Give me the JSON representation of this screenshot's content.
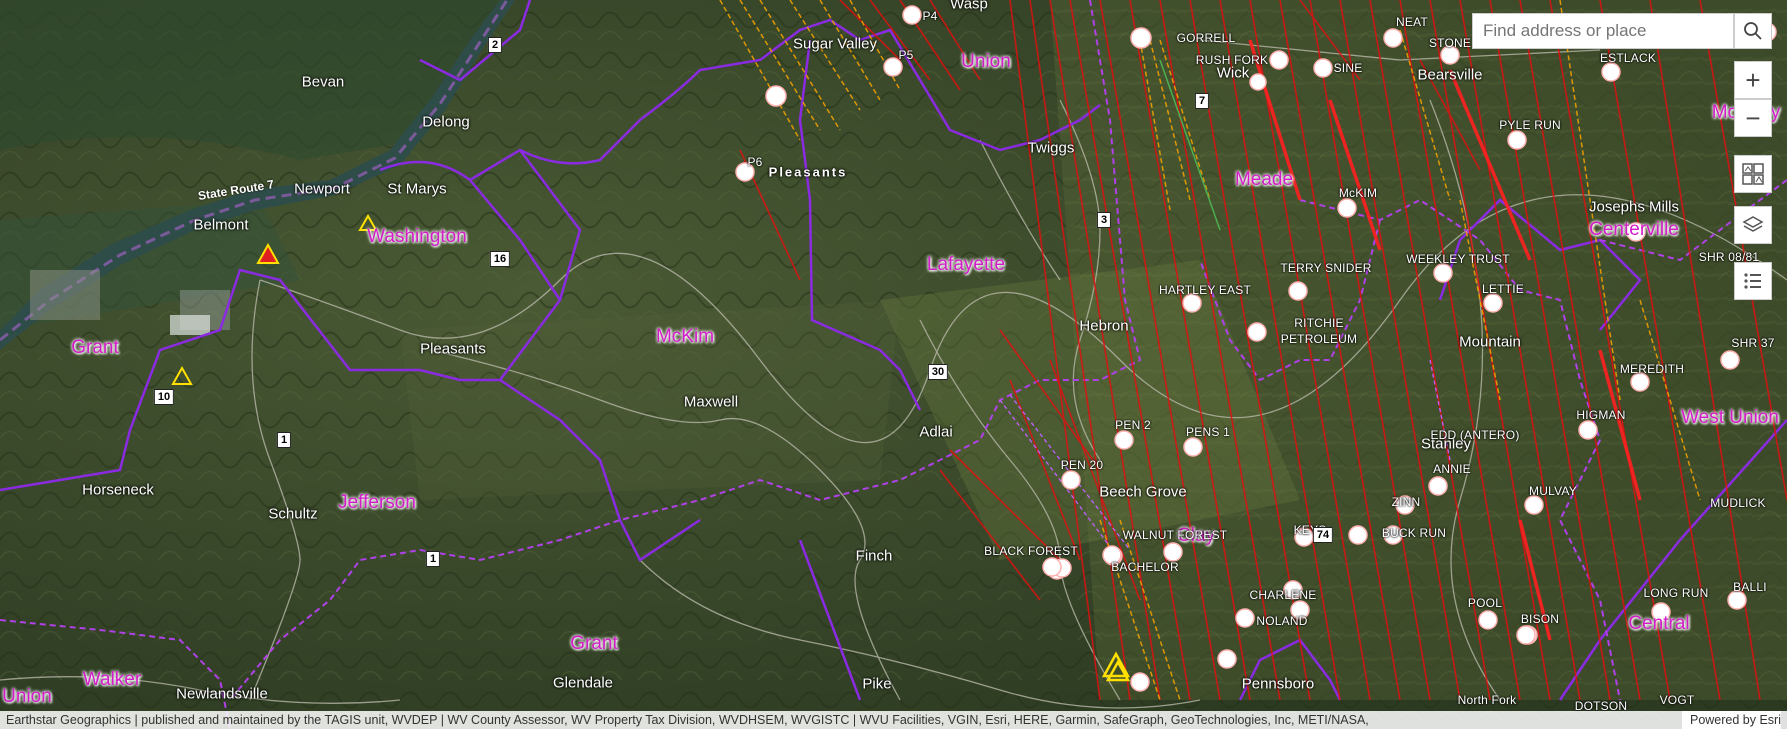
{
  "search": {
    "placeholder": "Find address or place"
  },
  "controls": {
    "zoom_in": "+",
    "zoom_out": "−"
  },
  "attribution": {
    "text": "Earthstar Geographics | published and maintained by the TAGIS unit, WVDEP | WV County Assessor, WV Property Tax Division, WVDHSEM, WVGISTC | WVU Facilities, VGIN, Esri, HERE, Garmin, SafeGraph, GeoTechnologies, Inc, METI/NASA,",
    "powered_by": "Powered by Esri"
  },
  "towns": [
    "Bevan",
    "Delong",
    "Newport",
    "St Marys",
    "Belmont",
    "Sugar Valley",
    "Wick",
    "Bearsville",
    "Twiggs",
    "Pleasants",
    "Hebron",
    "Joseph's Mills",
    "Mountain",
    "Maxwell",
    "Adlai",
    "Stanley",
    "Beech Grove",
    "Horseneck",
    "Schultz",
    "Finch",
    "Glendale",
    "Pike",
    "Newlandsville",
    "Pennsboro"
  ],
  "town_names": {
    "bevan": "Bevan",
    "delong": "Delong",
    "newport": "Newport",
    "stmarys": "St Marys",
    "belmont": "Belmont",
    "sugarvalley": "Sugar Valley",
    "wick": "Wick",
    "bearsville": "Bearsville",
    "twiggs": "Twiggs",
    "pleasants": "Pleasants",
    "pleasants_top": "Pleasants",
    "hebron": "Hebron",
    "josephsmills": "Josephs Mills",
    "mountain": "Mountain",
    "maxwell": "Maxwell",
    "adlai": "Adlai",
    "stanley": "Stanley",
    "beechgrove": "Beech Grove",
    "horseneck": "Horseneck",
    "schultz": "Schultz",
    "finch": "Finch",
    "glendale": "Glendale",
    "pike": "Pike",
    "newlandsville": "Newlandsville",
    "pennsboro": "Pennsboro",
    "wasp": "Wasp",
    "alma": "Alma"
  },
  "districts": {
    "union_top": "Union",
    "washington": "Washington",
    "meade": "Meade",
    "lafayette": "Lafayette",
    "grant_left": "Grant",
    "mckim": "McKim",
    "centerville": "Centerville",
    "jefferson": "Jefferson",
    "clay": "Clay",
    "westunion": "West Union",
    "grant_bottom": "Grant",
    "walker": "Walker",
    "union_bottom": "Union",
    "central": "Central",
    "mcelroy": "McElroy"
  },
  "leases": {
    "p4": "P4",
    "p5": "P5",
    "p6": "P6",
    "gorrell": "GORRELL",
    "rushfork": "RUSH FORK",
    "sine": "SINE",
    "neat": "NEAT",
    "stone": "STONE",
    "estlack": "ESTLACK",
    "shr": "SHR",
    "pylerun": "PYLE RUN",
    "mckim_l": "McKIM",
    "terrysnider": "TERRY SNIDER",
    "weekleytrust": "WEEKLEY TRUST",
    "shr081": "SHR 08/81",
    "hartleyeast": "HARTLEY EAST",
    "lettie": "LETTIE",
    "ritchie": "RITCHIE",
    "petroleum": "PETROLEUM",
    "shr37": "SHR 37",
    "meredith": "MEREDITH",
    "pen2": "PEN 2",
    "pens1": "PENS 1",
    "higman": "HIGMAN",
    "eddvantero": "EDD (ANTERO)",
    "pen20": "PEN 20",
    "annie": "ANNIE",
    "mulvay": "MULVAY",
    "zinn": "ZINN",
    "mudlick": "MUDLICK",
    "blackforest": "BLACK FOREST",
    "walnutforest": "WALNUT FOREST",
    "keys": "KEYS",
    "buckrun": "BUCK RUN",
    "bachelor": "BACHELOR",
    "charlene": "CHARLENE",
    "noland": "NOLAND",
    "longrun": "LONG RUN",
    "balli": "BALLI",
    "pool": "POOL",
    "bison": "BISON",
    "northfork": "North Fork",
    "dotson": "DOTSON",
    "vogt": "VOGT",
    "ce": "Ce"
  },
  "routes": {
    "r2": "2",
    "r16": "16",
    "r7": "7",
    "r3": "3",
    "r10": "10",
    "r1a": "1",
    "r1b": "1",
    "r30": "30",
    "r74": "74"
  },
  "road_labels": {
    "sr7": "State Route 7"
  },
  "colors": {
    "district_boundary": "#8a2be2",
    "district_label": "#d21cc8",
    "well_line": "#e01010",
    "permit_line": "#f0a000",
    "imagery": "#3a4a2a"
  }
}
